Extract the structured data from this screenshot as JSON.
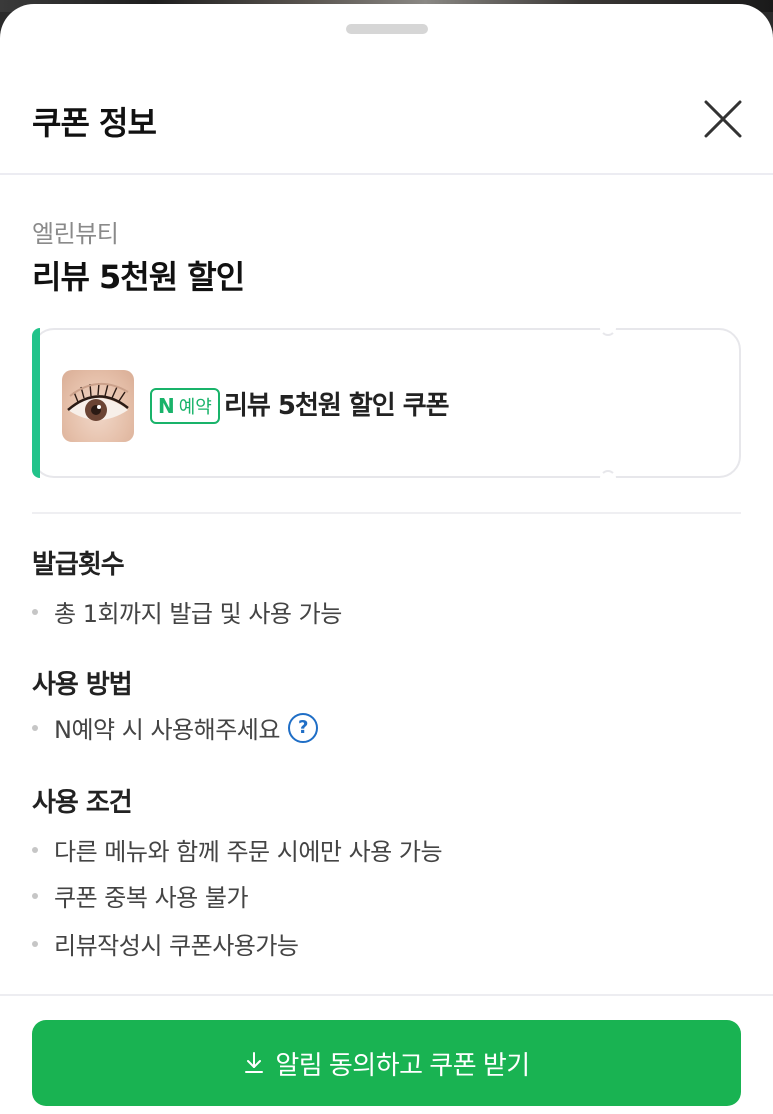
{
  "sheet": {
    "title": "쿠폰 정보"
  },
  "coupon": {
    "store_name": "엘린뷰티",
    "title": "리뷰 5천원 할인",
    "card": {
      "badge_n": "N",
      "badge_text": "예약",
      "name": "리뷰 5천원 할인 쿠폰",
      "accent_color": "#22c38a"
    }
  },
  "sections": {
    "issue_count": {
      "heading": "발급횟수",
      "items": [
        "총 1회까지 발급 및 사용 가능"
      ]
    },
    "usage_method": {
      "heading": "사용 방법",
      "items": [
        "N예약 시 사용해주세요"
      ]
    },
    "usage_conditions": {
      "heading": "사용 조건",
      "items": [
        "다른 메뉴와 함께 주문 시에만 사용 가능",
        "쿠폰 중복 사용 불가",
        "리뷰작성시 쿠폰사용가능"
      ]
    }
  },
  "cta": {
    "label": "알림 동의하고 쿠폰 받기",
    "color": "#19b352"
  },
  "icons": {
    "close": "close-icon",
    "help": "help-icon",
    "download": "download-icon"
  }
}
